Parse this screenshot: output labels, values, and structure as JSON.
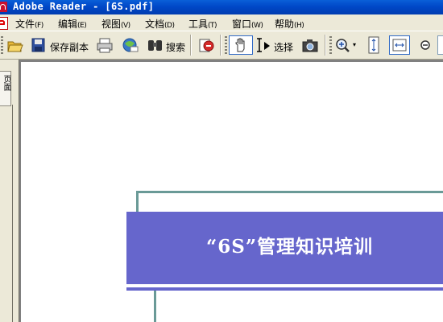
{
  "window": {
    "title": "Adobe Reader - [6S.pdf]"
  },
  "menu": [
    {
      "label": "文件",
      "accel": "(F)"
    },
    {
      "label": "编辑",
      "accel": "(E)"
    },
    {
      "label": "视图",
      "accel": "(V)"
    },
    {
      "label": "文档",
      "accel": "(D)"
    },
    {
      "label": "工具",
      "accel": "(T)"
    },
    {
      "label": "窗口",
      "accel": "(W)"
    },
    {
      "label": "帮助",
      "accel": "(H)"
    }
  ],
  "toolbar": {
    "save_copy_label": "保存副本",
    "search_label": "搜索",
    "select_label": "选择",
    "icons": [
      "open-folder-icon",
      "save-disk-icon",
      "print-icon",
      "email-icon",
      "binoculars-icon",
      "security-icon",
      "hand-tool-icon",
      "select-text-icon",
      "snapshot-camera-icon",
      "zoom-in-icon",
      "fit-page-icon",
      "fit-width-icon",
      "zoom-out-icon"
    ]
  },
  "navpanel": {
    "pages_tab": "页面"
  },
  "document": {
    "banner_title": "“6S”管理知识培训",
    "banner_color": "#6666cc",
    "frame_color": "#6a9a97"
  }
}
